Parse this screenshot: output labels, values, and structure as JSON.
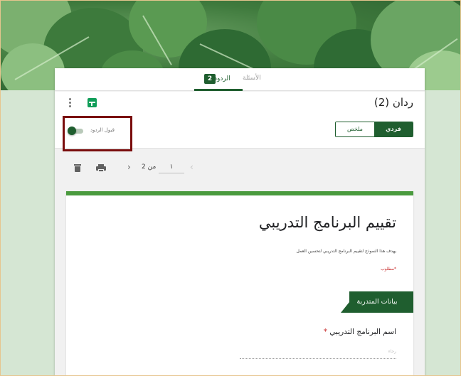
{
  "tabs": {
    "questions_label": "الأسئلة",
    "responses_label": "الردود",
    "responses_count": "2"
  },
  "summary": {
    "title": "ردان (2)",
    "view_summary": "ملخص",
    "view_individual": "فردي",
    "accept_responses_label": "قبول الردود",
    "accept_responses_on": true
  },
  "navigation": {
    "current": "١",
    "of_total": "من 2",
    "next_glyph": "›",
    "prev_glyph": "‹"
  },
  "form": {
    "title": "تقييم البرنامج التدريبي",
    "description": "يهدف هذا النموذج لتقييم البرنامج التدريبي لتحسين العمل",
    "required_note": "*مطلوب",
    "section_title": "بيانات المتدربة",
    "question_label": "اسم البرنامج التدريبي",
    "question_required_mark": "*",
    "answer": "رجاء"
  },
  "colors": {
    "accent": "#1f5e2f",
    "form_top": "#4a9a3e",
    "required": "#c62828",
    "highlight_box": "#7a0d0d",
    "page_background": "#d5e6d3"
  }
}
